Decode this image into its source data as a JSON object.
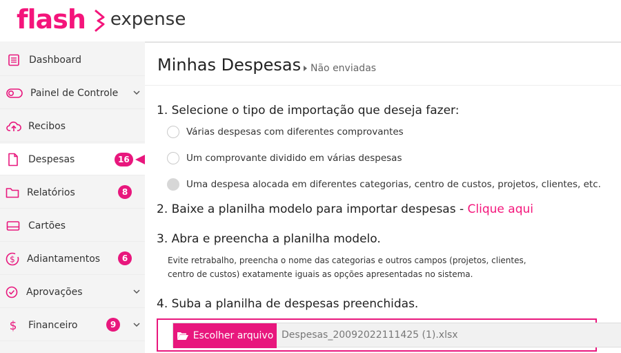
{
  "brand": {
    "name": "flash",
    "product": "expense",
    "color": "#f4157b"
  },
  "sidebar": {
    "items": [
      {
        "label": "Dashboard",
        "icon": "dashboard-icon"
      },
      {
        "label": "Painel de Controle",
        "icon": "toggle-icon",
        "expandable": true
      },
      {
        "label": "Recibos",
        "icon": "cloud-upload-icon"
      },
      {
        "label": "Despesas",
        "icon": "document-icon",
        "badge": "16",
        "active": true
      },
      {
        "label": "Relatórios",
        "icon": "folder-icon",
        "badge": "8"
      },
      {
        "label": "Cartões",
        "icon": "card-icon"
      },
      {
        "label": "Adiantamentos",
        "icon": "dollar-circle-icon",
        "badge": "6"
      },
      {
        "label": "Aprovações",
        "icon": "check-circle-icon",
        "expandable": true
      },
      {
        "label": "Financeiro",
        "icon": "dollar-icon",
        "badge": "9",
        "expandable": true
      }
    ]
  },
  "main": {
    "title": "Minhas Despesas",
    "breadcrumb": "Não enviadas",
    "step1": {
      "text": "1. Selecione o tipo de importação que deseja fazer:",
      "options": [
        "Várias despesas com diferentes comprovantes",
        "Um comprovante dividido em várias despesas",
        "Uma despesa alocada em diferentes categorias, centro de custos, projetos, clientes, etc."
      ]
    },
    "step2": {
      "text": "2. Baixe a planilha modelo para importar despesas - ",
      "link": "Clique aqui"
    },
    "step3": {
      "text": "3. Abra e preencha a planilha modelo.",
      "note_line1": "Evite retrabalho, preencha o nome das categorias e outros campos (projetos, clientes,",
      "note_line2": "centro de custos) exatamente iguais as opções apresentadas no sistema."
    },
    "step4": {
      "text": "4. Suba a planilha de despesas preenchidas.",
      "button_label": "Escolher arquivo",
      "file_name": "Despesas_20092022111425 (1).xlsx"
    }
  }
}
